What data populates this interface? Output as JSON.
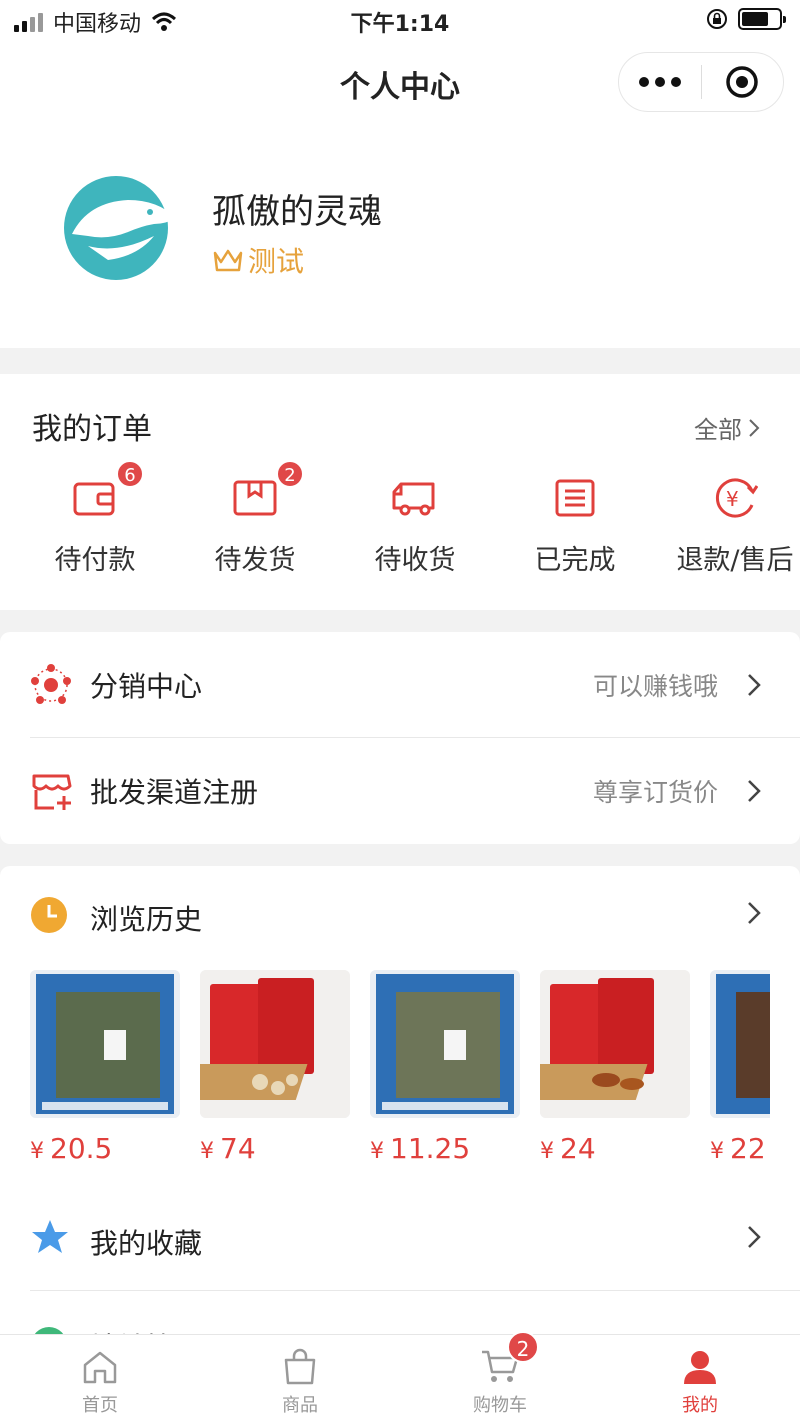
{
  "status": {
    "carrier": "中国移动",
    "time": "下午1:14"
  },
  "nav": {
    "title": "个人中心"
  },
  "profile": {
    "nickname": "孤傲的灵魂",
    "level": "测试"
  },
  "orders": {
    "title": "我的订单",
    "all_label": "全部",
    "items": [
      {
        "label": "待付款",
        "badge": "6",
        "icon": "wallet-icon"
      },
      {
        "label": "待发货",
        "badge": "2",
        "icon": "package-icon"
      },
      {
        "label": "待收货",
        "badge": "",
        "icon": "truck-icon"
      },
      {
        "label": "已完成",
        "badge": "",
        "icon": "document-icon"
      },
      {
        "label": "退款/售后",
        "badge": "",
        "icon": "refund-icon"
      }
    ]
  },
  "menu": {
    "distribution": {
      "label": "分销中心",
      "hint": "可以赚钱哦"
    },
    "wholesale": {
      "label": "批发渠道注册",
      "hint": "尊享订货价"
    }
  },
  "history": {
    "title": "浏览历史",
    "products": [
      {
        "price": "20.5",
        "theme": "blue-pack"
      },
      {
        "price": "74",
        "theme": "red-pack"
      },
      {
        "price": "11.25",
        "theme": "blue-pack"
      },
      {
        "price": "24",
        "theme": "red-pack"
      },
      {
        "price": "22",
        "theme": "blue-pack"
      }
    ],
    "currency": "¥"
  },
  "favorites": {
    "label": "我的收藏"
  },
  "address": {
    "label": "地址管理"
  },
  "tabbar": {
    "items": [
      {
        "label": "首页",
        "icon": "home-icon",
        "active": false
      },
      {
        "label": "商品",
        "icon": "bag-icon",
        "active": false
      },
      {
        "label": "购物车",
        "icon": "cart-icon",
        "active": false,
        "badge": "2"
      },
      {
        "label": "我的",
        "icon": "user-icon",
        "active": true
      }
    ]
  },
  "colors": {
    "accent": "#e0403c",
    "gold": "#e6a23c",
    "teal": "#3fb5bd",
    "icon_blue": "#4a9be8"
  }
}
